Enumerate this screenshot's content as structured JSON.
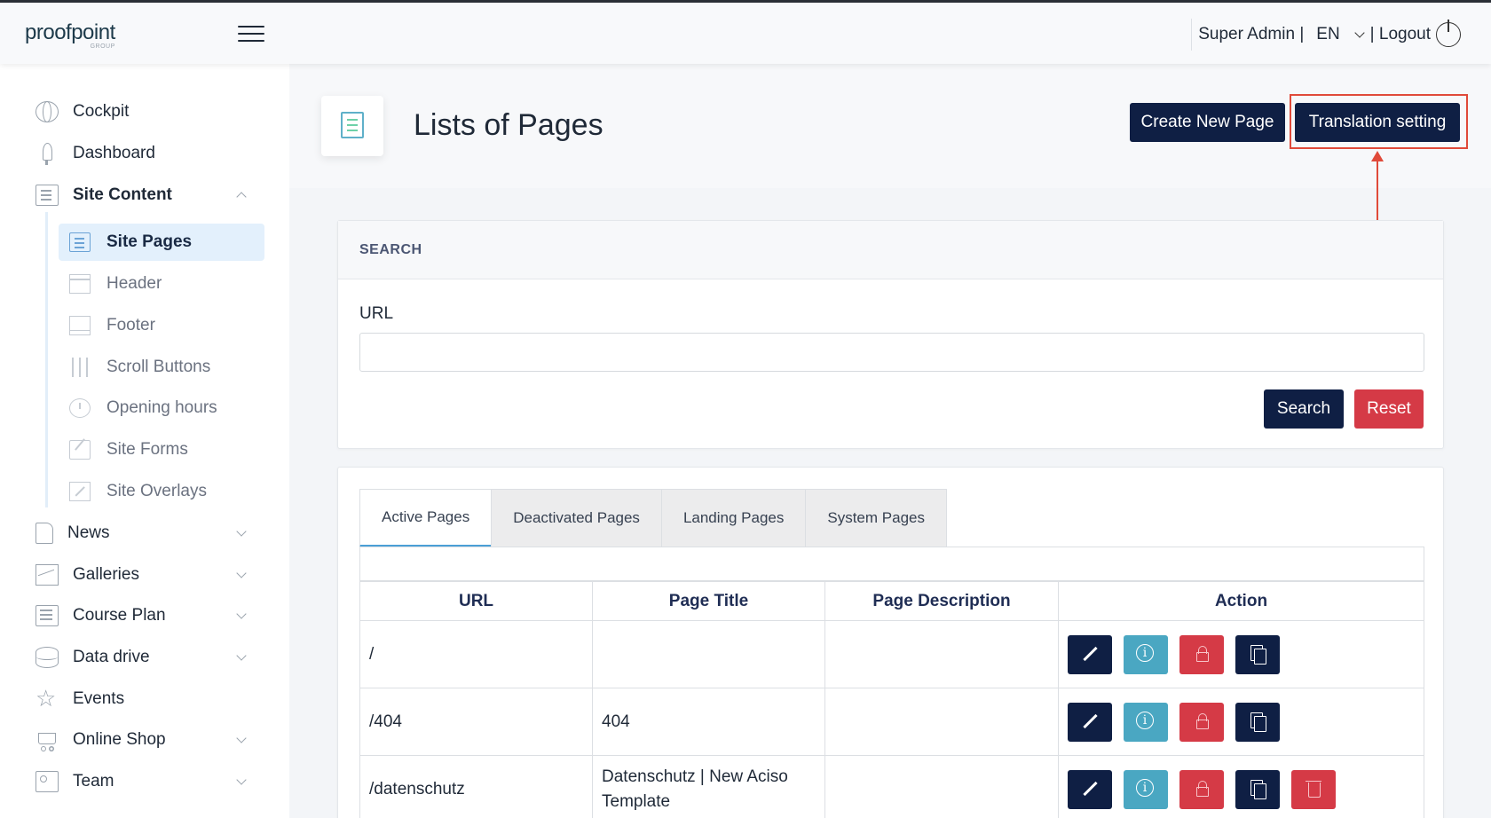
{
  "topbar": {
    "logo": "proofpoint",
    "logo_sub": "GROUP",
    "user": "Super Admin |",
    "language": "EN",
    "logout": "| Logout"
  },
  "sidebar": {
    "items": [
      {
        "label": "Cockpit",
        "icon": "globe-icon"
      },
      {
        "label": "Dashboard",
        "icon": "rocket-icon"
      },
      {
        "label": "Site Content",
        "icon": "pages-icon",
        "expanded": true
      },
      {
        "label": "News",
        "icon": "document-icon"
      },
      {
        "label": "Galleries",
        "icon": "image-icon"
      },
      {
        "label": "Course Plan",
        "icon": "board-icon"
      },
      {
        "label": "Data drive",
        "icon": "database-icon"
      },
      {
        "label": "Events",
        "icon": "star-icon"
      },
      {
        "label": "Online Shop",
        "icon": "cart-icon"
      },
      {
        "label": "Team",
        "icon": "team-icon"
      }
    ],
    "sub_items": [
      {
        "label": "Site Pages",
        "icon": "pages-icon",
        "active": true
      },
      {
        "label": "Header",
        "icon": "header-icon"
      },
      {
        "label": "Footer",
        "icon": "footer-icon"
      },
      {
        "label": "Scroll Buttons",
        "icon": "sliders-icon"
      },
      {
        "label": "Opening hours",
        "icon": "clock-icon"
      },
      {
        "label": "Site Forms",
        "icon": "form-icon"
      },
      {
        "label": "Site Overlays",
        "icon": "overlay-icon"
      }
    ]
  },
  "header": {
    "title": "Lists of Pages",
    "create_button": "Create New Page",
    "translation_button": "Translation setting"
  },
  "search": {
    "heading": "SEARCH",
    "url_label": "URL",
    "url_value": "",
    "search_button": "Search",
    "reset_button": "Reset"
  },
  "tabs": [
    "Active Pages",
    "Deactivated Pages",
    "Landing Pages",
    "System Pages"
  ],
  "table": {
    "columns": [
      "URL",
      "Page Title",
      "Page Description",
      "Action"
    ],
    "rows": [
      {
        "url": "/",
        "title": "",
        "description": ""
      },
      {
        "url": "/404",
        "title": "404",
        "description": ""
      },
      {
        "url": "/datenschutz",
        "title": "Datenschutz | New Aciso Template",
        "description": ""
      }
    ]
  },
  "colors": {
    "primary": "#0f1f44",
    "danger": "#d53a46",
    "info": "#4aa7c2",
    "highlight": "#e04a3a"
  }
}
